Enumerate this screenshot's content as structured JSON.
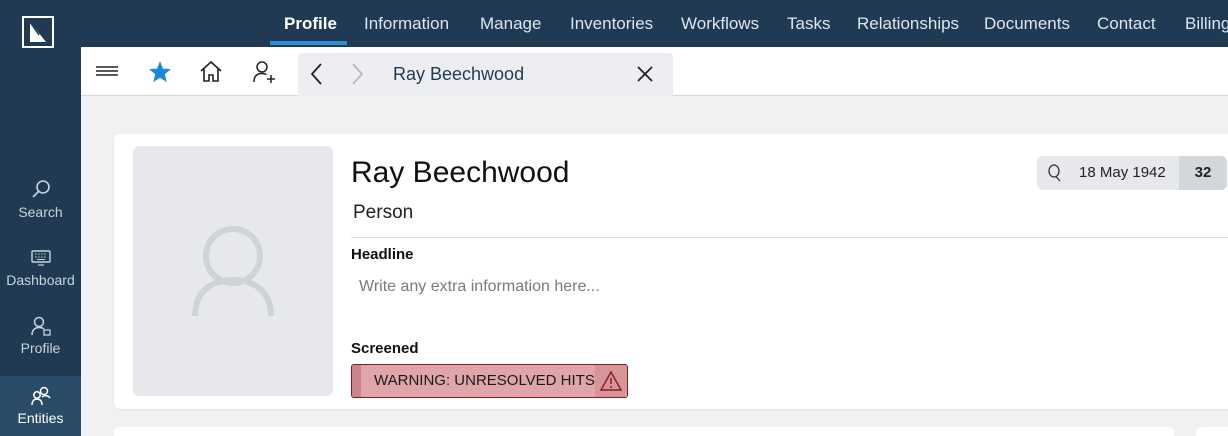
{
  "colors": {
    "nav_bg": "#1f3a52",
    "accent": "#2b8fd6",
    "warning_bg": "#e0a5a8",
    "warning_border": "#8b1a1f"
  },
  "rail": {
    "items": [
      {
        "label": "Search",
        "icon": "search-icon"
      },
      {
        "label": "Dashboard",
        "icon": "keyboard-icon"
      },
      {
        "label": "Profile",
        "icon": "profile-icon"
      },
      {
        "label": "Entities",
        "icon": "entities-icon",
        "active": true
      }
    ]
  },
  "topnav": {
    "tabs": [
      "Profile",
      "Information",
      "Manage",
      "Inventories",
      "Workflows",
      "Tasks",
      "Relationships",
      "Documents",
      "Contact",
      "Billing"
    ],
    "active": "Profile"
  },
  "toolbar": {
    "icons": [
      "menu-icon",
      "star-icon",
      "home-icon",
      "add-person-icon"
    ],
    "doc_tab": {
      "title": "Ray Beechwood"
    }
  },
  "profile": {
    "name": "Ray Beechwood",
    "entity_type": "Person",
    "dob": "18 May 1942",
    "age": "32",
    "headline_label": "Headline",
    "headline_placeholder": "Write any extra information here...",
    "screened_label": "Screened",
    "screened_status": "WARNING: UNRESOLVED HITS"
  }
}
